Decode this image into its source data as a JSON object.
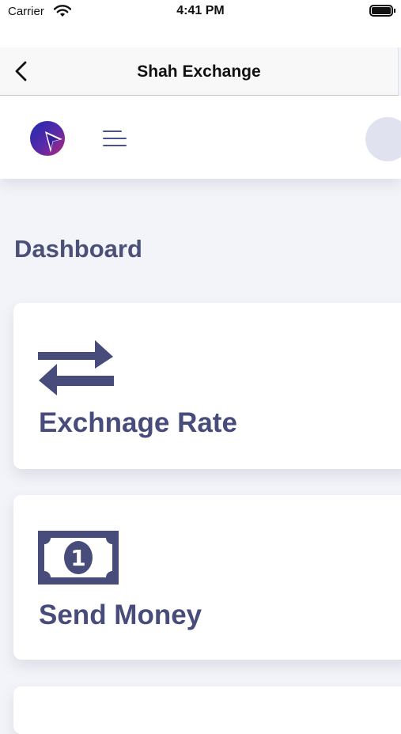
{
  "status_bar": {
    "carrier": "Carrier",
    "time": "4:41 PM",
    "icons": [
      "wifi-icon",
      "battery-icon"
    ]
  },
  "nav_bar": {
    "title": "Shah Exchange",
    "back_icon": "chevron-left-icon"
  },
  "app_header": {
    "logo_icon": "logo-icon",
    "menu_icon": "hamburger-menu-icon",
    "avatar_icon": "avatar"
  },
  "dashboard": {
    "title": "Dashboard",
    "cards": [
      {
        "label": "Exchnage Rate",
        "icon": "exchange-arrows-icon"
      },
      {
        "label": "Send Money",
        "icon": "banknote-icon"
      }
    ]
  },
  "colors": {
    "text_primary": "#474c7b",
    "icon_primary": "#474c7b",
    "background": "#f3f4f9",
    "card": "#ffffff",
    "logo_gradient": [
      "#1e2bb0",
      "#a0267f"
    ]
  }
}
